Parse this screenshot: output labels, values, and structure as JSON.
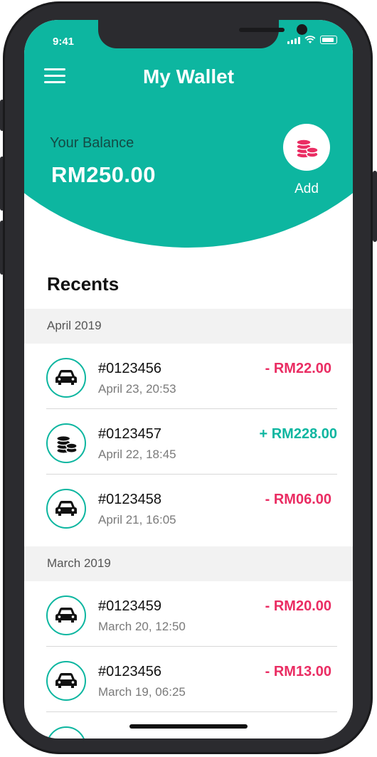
{
  "status_bar": {
    "time": "9:41"
  },
  "header": {
    "title": "My Wallet"
  },
  "balance": {
    "label": "Your Balance",
    "amount": "RM250.00",
    "add_label": "Add"
  },
  "colors": {
    "accent": "#0db6a0",
    "negative": "#ea2d63",
    "positive": "#0db6a0"
  },
  "recents_title": "Recents",
  "groups": [
    {
      "month": "April 2019",
      "transactions": [
        {
          "icon": "car-icon",
          "id": "#0123456",
          "date": "April 23, 20:53",
          "amount": "- RM22.00",
          "type": "debit"
        },
        {
          "icon": "coins-icon",
          "id": "#0123457",
          "date": "April 22, 18:45",
          "amount": "+ RM228.00",
          "type": "credit"
        },
        {
          "icon": "car-icon",
          "id": "#0123458",
          "date": "April 21, 16:05",
          "amount": "- RM06.00",
          "type": "debit"
        }
      ]
    },
    {
      "month": "March 2019",
      "transactions": [
        {
          "icon": "car-icon",
          "id": "#0123459",
          "date": "March 20, 12:50",
          "amount": "- RM20.00",
          "type": "debit"
        },
        {
          "icon": "car-icon",
          "id": "#0123456",
          "date": "March 19, 06:25",
          "amount": "- RM13.00",
          "type": "debit"
        }
      ]
    }
  ]
}
